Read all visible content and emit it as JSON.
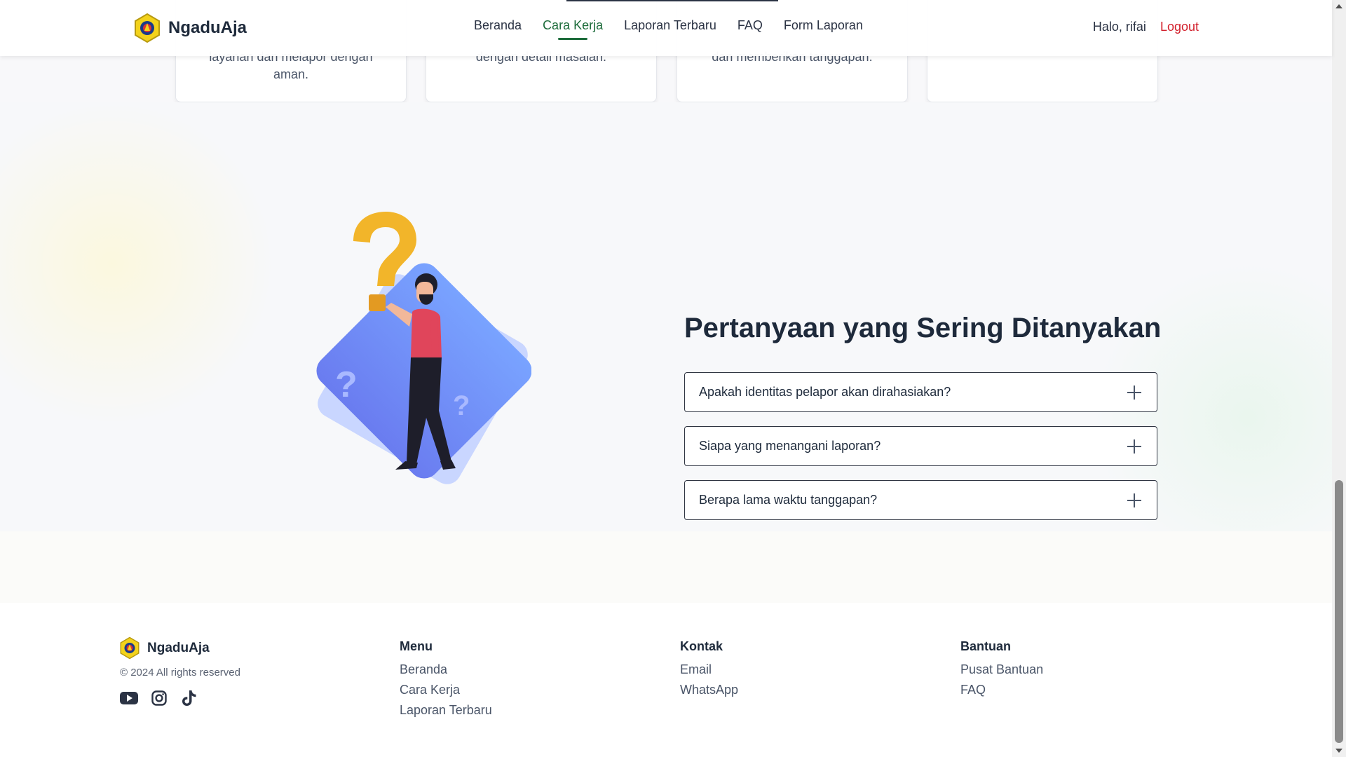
{
  "brand": {
    "name": "NgaduAja"
  },
  "nav": {
    "items": [
      {
        "label": "Beranda"
      },
      {
        "label": "Cara Kerja"
      },
      {
        "label": "Laporan Terbaru"
      },
      {
        "label": "FAQ"
      },
      {
        "label": "Form Laporan"
      }
    ],
    "active": "Cara Kerja",
    "greeting": "Halo, rifai",
    "logout_label": "Logout"
  },
  "steps": [
    {
      "text": "layanan dan melapor dengan aman."
    },
    {
      "text": "dengan detail masalah."
    },
    {
      "text": "dan memberikan tanggapan."
    },
    {
      "text": ""
    }
  ],
  "faq": {
    "title": "Pertanyaan yang Sering Ditanyakan",
    "items": [
      {
        "question": "Apakah identitas pelapor akan dirahasiakan?"
      },
      {
        "question": "Siapa yang menangani laporan?"
      },
      {
        "question": "Berapa lama waktu tanggapan?"
      }
    ]
  },
  "footer": {
    "brand_name": "NgaduAja",
    "copyright": "© 2024 All rights reserved",
    "socials": [
      "youtube-icon",
      "instagram-icon",
      "tiktok-icon"
    ],
    "columns": [
      {
        "title": "Menu",
        "links": [
          "Beranda",
          "Cara Kerja",
          "Laporan Terbaru"
        ]
      },
      {
        "title": "Kontak",
        "links": [
          "Email",
          "WhatsApp"
        ]
      },
      {
        "title": "Bantuan",
        "links": [
          "Pusat Bantuan",
          "FAQ"
        ]
      }
    ]
  },
  "colors": {
    "accent_green": "#1c6b3a",
    "logout_red": "#d21f2b",
    "text_dark": "#1e2a3b"
  }
}
